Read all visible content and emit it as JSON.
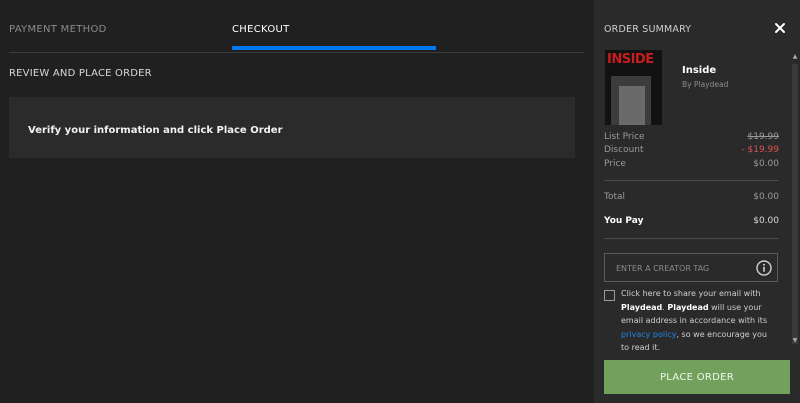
{
  "tabs": [
    {
      "label": "PAYMENT METHOD",
      "active": false
    },
    {
      "label": "CHECKOUT",
      "active": true
    }
  ],
  "main": {
    "section_title": "REVIEW AND PLACE ORDER",
    "info_message": "Verify your information and click Place Order"
  },
  "summary": {
    "title": "ORDER SUMMARY",
    "product": {
      "thumbnail_text": "INSIDE",
      "title": "Inside",
      "publisher": "By Playdead"
    },
    "list_price_label": "List Price",
    "list_price_value": "$19.99",
    "discount_label": "Discount",
    "discount_value": "- $19.99",
    "price_label": "Price",
    "price_value": "$0.00",
    "total_label": "Total",
    "total_value": "$0.00",
    "you_pay_label": "You Pay",
    "you_pay_value": "$0.00",
    "creator_tag_placeholder": "ENTER A CREATOR TAG",
    "consent": {
      "part1": "Click here to share your email with ",
      "publisher_bold1": "Playdead",
      "part2": ". ",
      "publisher_bold2": "Playdead",
      "part3": " will use your email address in accordance with its ",
      "privacy_link": "privacy policy",
      "part4": ", so we encourage you to read it."
    },
    "place_order_label": "PLACE ORDER"
  },
  "colors": {
    "accent_blue": "#0078f2",
    "place_order_green": "#72a15e",
    "discount_red": "#d75353",
    "background": "#202020",
    "panel": "#2a2a2a"
  },
  "icons": [
    "close-icon",
    "info-icon",
    "scroll-up-icon",
    "scroll-down-icon"
  ]
}
